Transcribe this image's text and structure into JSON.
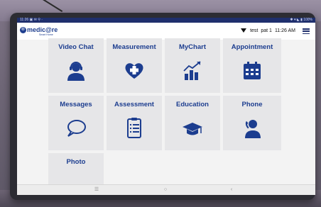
{
  "status_bar": {
    "left": "11:26 ▣ ✉ ⚲ ·",
    "right": "✱ ▾ ◣ ▮ 100%"
  },
  "header": {
    "logo_mark": "®",
    "logo_text": "medic@re",
    "logo_sub": "Smart Home",
    "username": "test",
    "patient": "pat 1",
    "time": "11:26 AM"
  },
  "tiles": [
    {
      "label": "Video Chat",
      "icon": "video-chat-agent-icon"
    },
    {
      "label": "Measurement",
      "icon": "heart-medical-cross-icon"
    },
    {
      "label": "MyChart",
      "icon": "bar-chart-trend-icon"
    },
    {
      "label": "Appointment",
      "icon": "calendar-icon"
    },
    {
      "label": "Messages",
      "icon": "speech-bubble-icon"
    },
    {
      "label": "Assessment",
      "icon": "clipboard-checklist-icon"
    },
    {
      "label": "Education",
      "icon": "graduation-cap-icon"
    },
    {
      "label": "Phone",
      "icon": "phone-call-person-icon"
    },
    {
      "label": "Photo",
      "icon": "photo-icon"
    }
  ],
  "nav": {
    "recents": "☰",
    "home": "○",
    "back": "‹"
  },
  "colors": {
    "accent": "#1c3d8f",
    "status_bar": "#1f2f6d",
    "tile_bg": "#e6e6e8"
  }
}
